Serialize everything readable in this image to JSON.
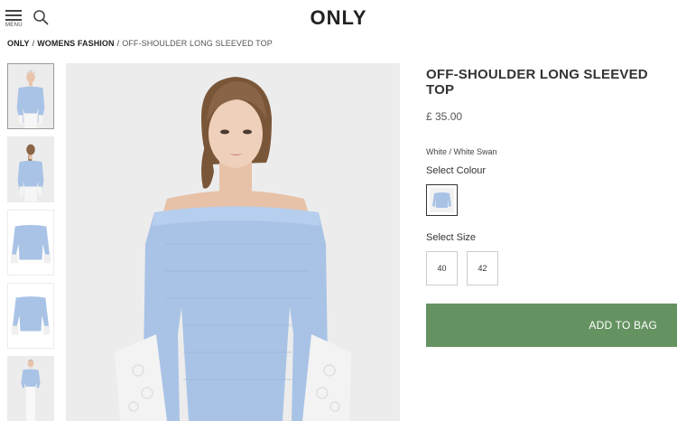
{
  "header": {
    "menu_label": "MENU",
    "logo": "ONLY"
  },
  "breadcrumb": {
    "items": [
      "ONLY",
      "WOMENS FASHION"
    ],
    "separator": "/",
    "current": "OFF-SHOULDER LONG SLEEVED TOP"
  },
  "product": {
    "title": "OFF-SHOULDER LONG SLEEVED TOP",
    "price": "£ 35.00",
    "colour_name": "White / White Swan",
    "select_colour_label": "Select Colour",
    "select_size_label": "Select Size",
    "sizes": [
      "40",
      "42"
    ],
    "add_to_bag_label": "ADD TO BAG"
  },
  "gallery": {
    "thumbnails": [
      {
        "view": "front",
        "selected": true
      },
      {
        "view": "back",
        "selected": false
      },
      {
        "view": "flat-front",
        "selected": false
      },
      {
        "view": "flat-back",
        "selected": false
      },
      {
        "view": "full-body",
        "selected": false
      }
    ],
    "main_view": "front"
  },
  "colors": {
    "accent": "#649361",
    "image_background": "#ececec",
    "garment_blue": "#a9c3e6"
  }
}
